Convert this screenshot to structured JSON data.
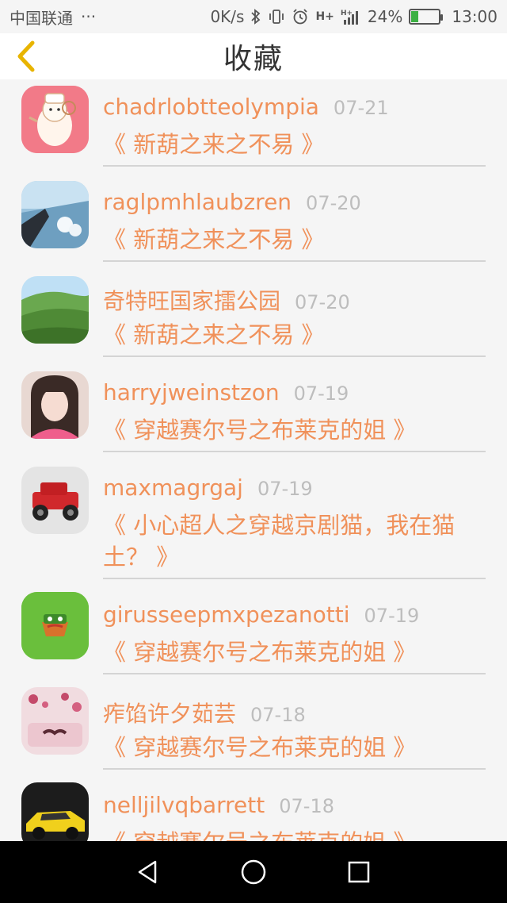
{
  "status_bar": {
    "carrier": "中国联通",
    "dots": "···",
    "speed": "0K/s",
    "signal_1": "H+",
    "signal_2": "H+",
    "battery_pct": "24%",
    "battery_level": 0.24,
    "time": "13:00"
  },
  "header": {
    "title": "收藏"
  },
  "items": [
    {
      "name": "chadrlobtteolympia",
      "date": "07-21",
      "book": "《 新葫之来之不易 》"
    },
    {
      "name": "raglpmhlaubzren",
      "date": "07-20",
      "book": "《 新葫之来之不易 》"
    },
    {
      "name": "奇特旺国家擂公园",
      "date": "07-20",
      "book": "《 新葫之来之不易 》"
    },
    {
      "name": "harryjweinstzon",
      "date": "07-19",
      "book": "《 穿越赛尔号之布莱克的姐 》"
    },
    {
      "name": "maxmagrgaj",
      "date": "07-19",
      "book": "《 小心超人之穿越京剧猫，我在猫土？ 》"
    },
    {
      "name": "girusseepmxpezanotti",
      "date": "07-19",
      "book": "《 穿越赛尔号之布莱克的姐 》"
    },
    {
      "name": "痄馅许夕茹芸",
      "date": "07-18",
      "book": "《 穿越赛尔号之布莱克的姐 》"
    },
    {
      "name": "nelljilvqbarrett",
      "date": "07-18",
      "book": "《 穿越赛尔号之布莱克的姐 》"
    }
  ],
  "colors": {
    "accent": "#f0915a",
    "date": "#bdbdbd",
    "back_icon": "#e8b400"
  }
}
